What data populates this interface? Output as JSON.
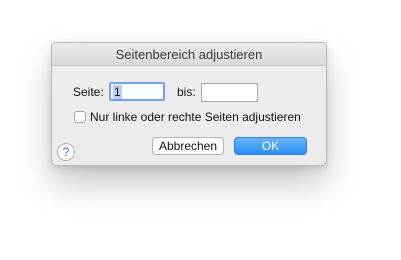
{
  "dialog": {
    "title": "Seitenbereich adjustieren",
    "page_from": {
      "label": "Seite:",
      "value": "1"
    },
    "page_to": {
      "label": "bis:",
      "value": ""
    },
    "checkbox": {
      "label": "Nur linke oder rechte Seiten adjustieren",
      "checked": false
    },
    "help_symbol": "?",
    "buttons": {
      "cancel": "Abbrechen",
      "ok": "OK"
    }
  },
  "colors": {
    "accent": "#2a8ef7",
    "focus_ring": "#6ea4f2",
    "selection": "#b5d0f7",
    "dialog_bg": "#ececec"
  },
  "icons": {
    "help": "question-mark-circle-icon"
  }
}
